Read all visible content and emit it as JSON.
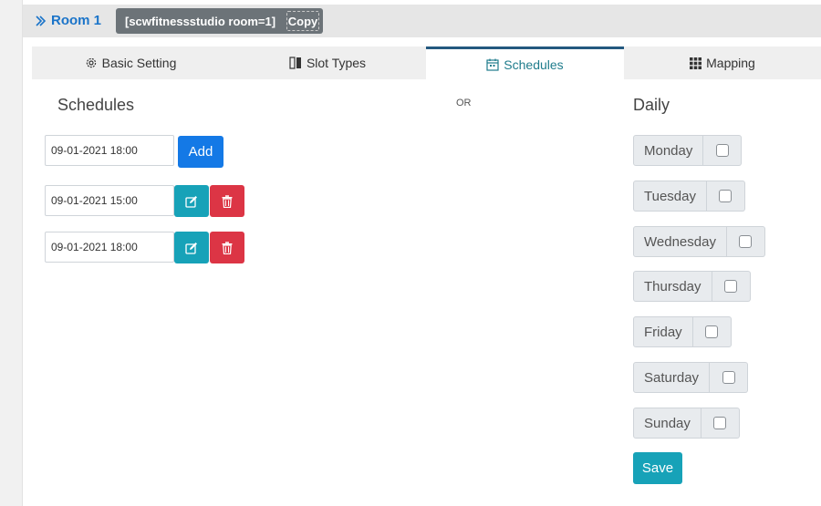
{
  "header": {
    "room_title": "Room 1",
    "shortcode": "[scwfitnessstudio room=1]",
    "copy_label": "Copy"
  },
  "tabs": [
    {
      "label": "Basic Setting",
      "icon": "gear-icon"
    },
    {
      "label": "Slot Types",
      "icon": "columns-icon"
    },
    {
      "label": "Schedules",
      "icon": "calendar-icon",
      "active": true
    },
    {
      "label": "Mapping",
      "icon": "grid-icon"
    }
  ],
  "schedules": {
    "title": "Schedules",
    "new_entry_value": "09-01-2021 18:00",
    "add_label": "Add",
    "items": [
      {
        "value": "09-01-2021 15:00"
      },
      {
        "value": "09-01-2021 18:00"
      }
    ]
  },
  "or_label": "OR",
  "daily": {
    "title": "Daily",
    "days": [
      "Monday",
      "Tuesday",
      "Wednesday",
      "Thursday",
      "Friday",
      "Saturday",
      "Sunday"
    ],
    "save_label": "Save"
  },
  "colors": {
    "primary": "#1479e6",
    "info": "#17a2b8",
    "danger": "#dc3545",
    "link": "#1b74c9",
    "tab_active_border": "#23587f"
  }
}
